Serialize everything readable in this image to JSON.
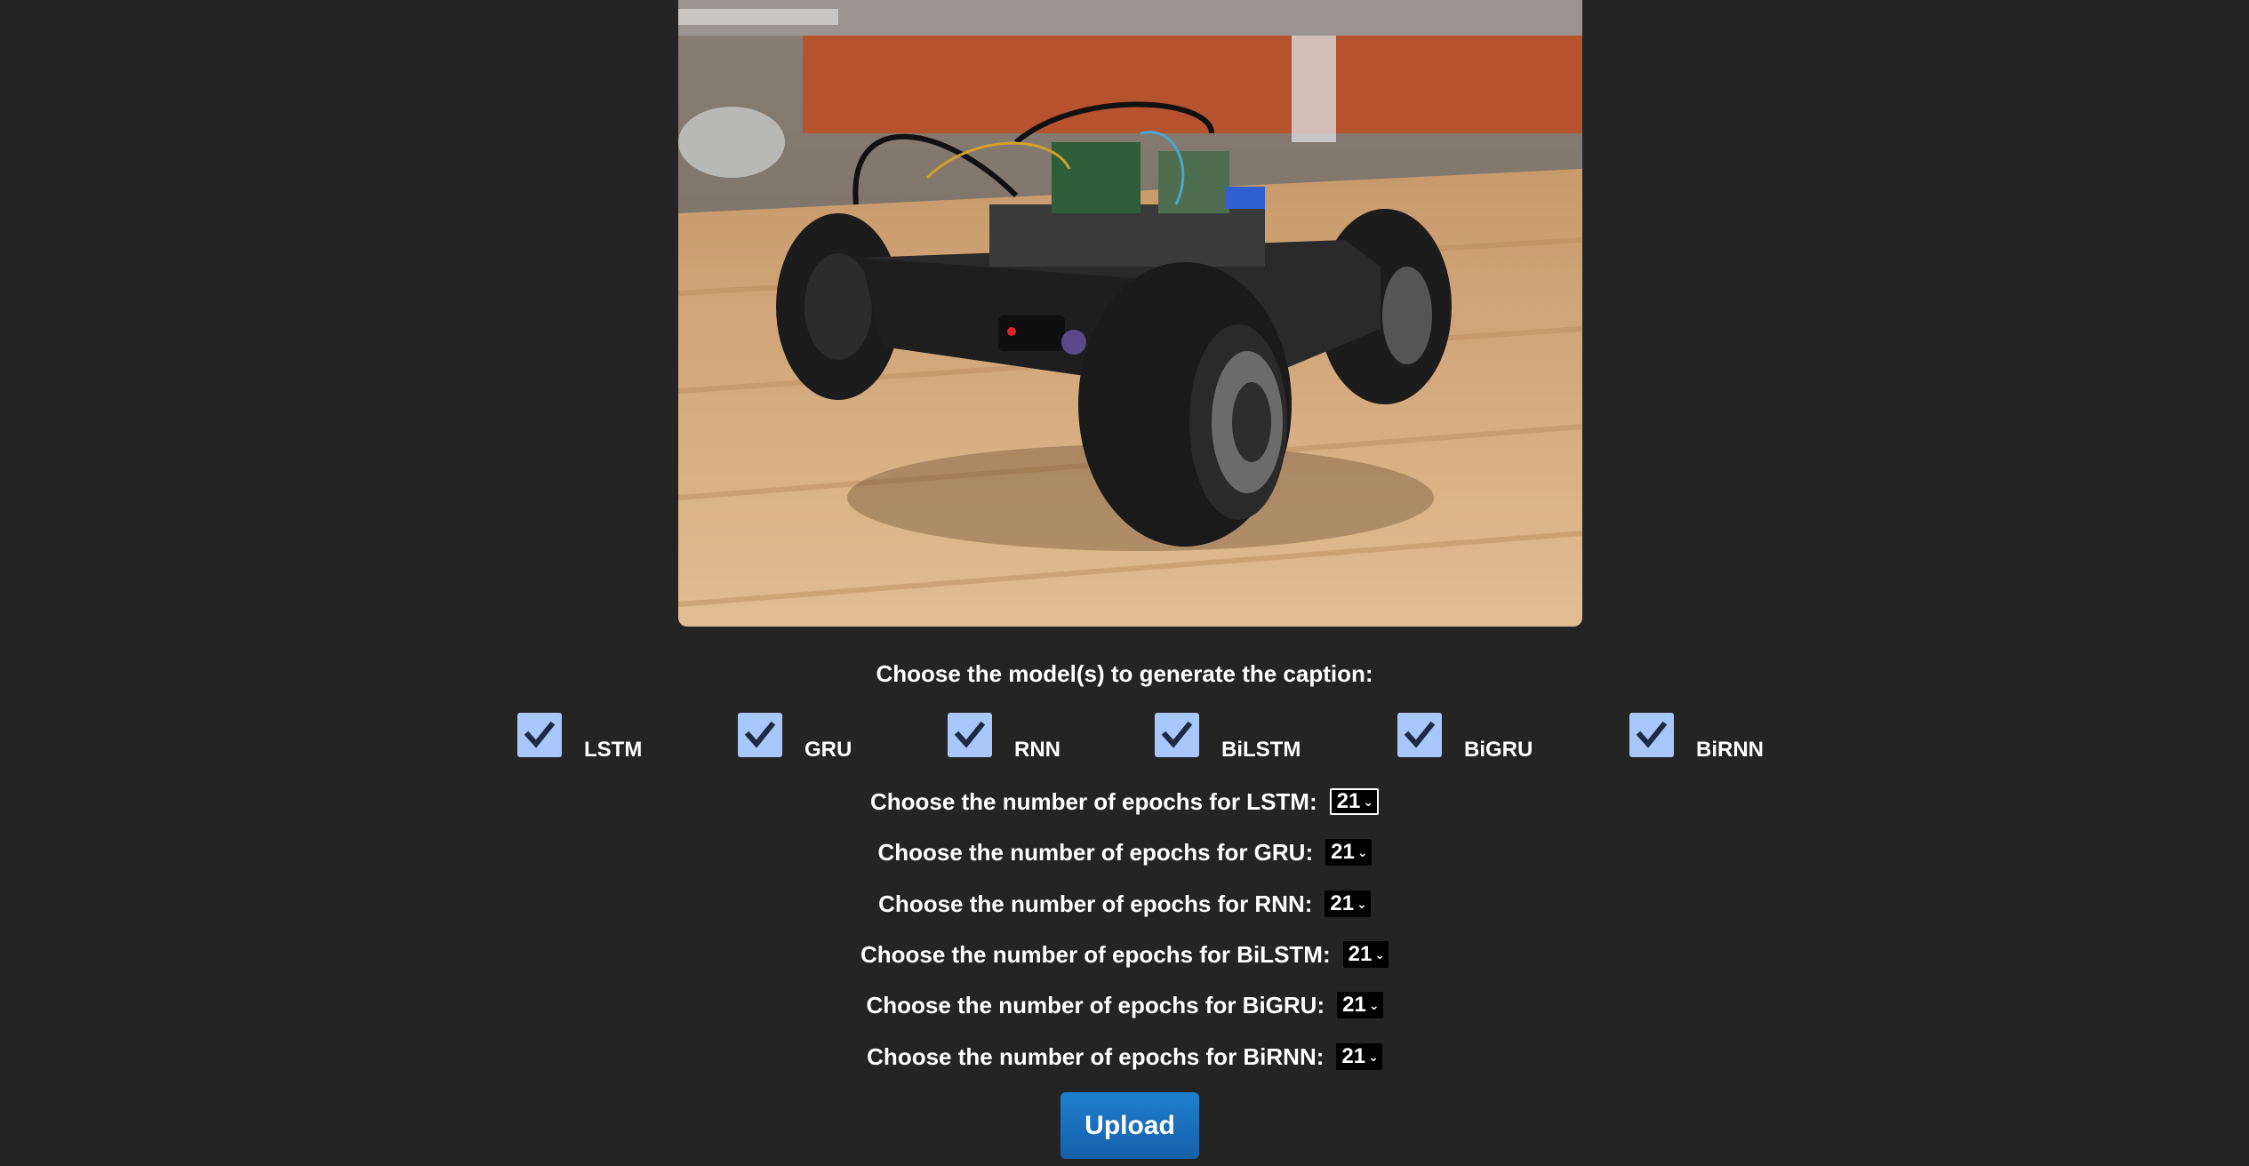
{
  "image": {
    "subject": "four-wheel robot car on a wooden table"
  },
  "form": {
    "model_prompt": "Choose the model(s) to generate the caption:",
    "models": [
      {
        "label": "LSTM",
        "checked": true
      },
      {
        "label": "GRU",
        "checked": true
      },
      {
        "label": "RNN",
        "checked": true
      },
      {
        "label": "BiLSTM",
        "checked": true
      },
      {
        "label": "BiGRU",
        "checked": true
      },
      {
        "label": "BiRNN",
        "checked": true
      }
    ],
    "epochs": [
      {
        "label": "Choose the number of epochs for LSTM:",
        "value": "21"
      },
      {
        "label": "Choose the number of epochs for GRU:",
        "value": "21"
      },
      {
        "label": "Choose the number of epochs for RNN:",
        "value": "21"
      },
      {
        "label": "Choose the number of epochs for BiLSTM:",
        "value": "21"
      },
      {
        "label": "Choose the number of epochs for BiGRU:",
        "value": "21"
      },
      {
        "label": "Choose the number of epochs for BiRNN:",
        "value": "21"
      }
    ],
    "upload_label": "Upload"
  },
  "colors": {
    "background": "#242424",
    "checkbox": "#a8c7fa",
    "button": "#1f7fd0"
  }
}
